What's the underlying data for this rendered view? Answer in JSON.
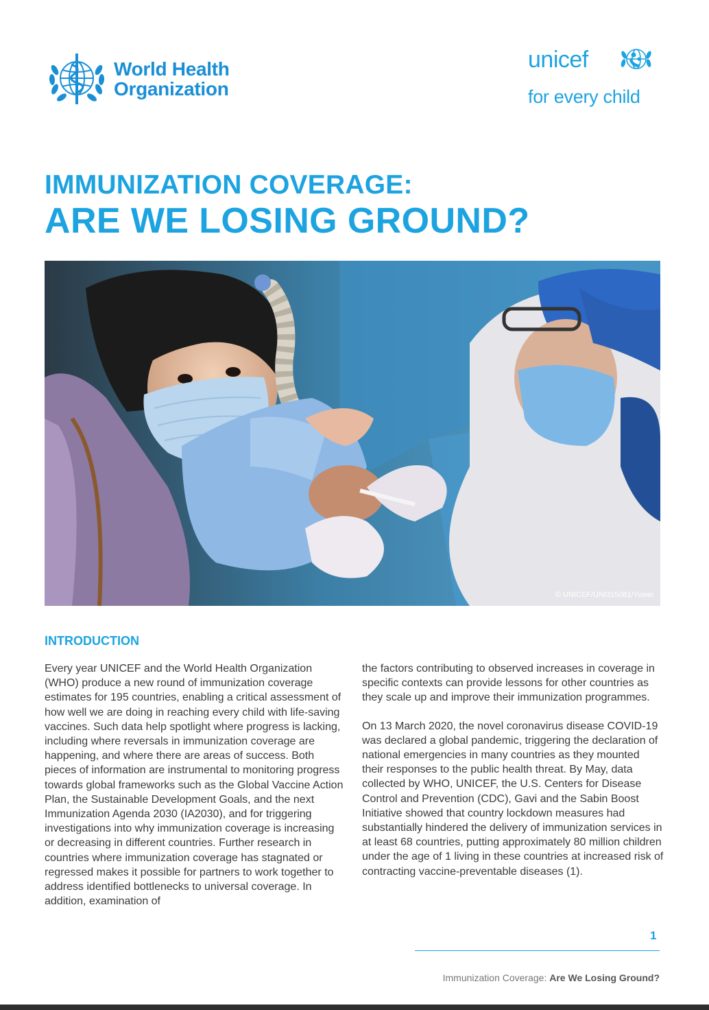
{
  "logos": {
    "who": {
      "line1": "World Health",
      "line2": "Organization",
      "color": "#1a8fd6"
    },
    "unicef": {
      "name": "unicef",
      "tagline": "for every child",
      "color": "#1ca3e0"
    }
  },
  "title": {
    "line1": "IMMUNIZATION COVERAGE:",
    "line2": "ARE WE LOSING GROUND?",
    "color": "#1ca3e0"
  },
  "photo": {
    "credit": "© UNICEF/UNI315081/Yuwei"
  },
  "intro": {
    "heading": "INTRODUCTION",
    "left_paragraph": "Every year UNICEF and the World Health Organization (WHO) produce a new round of immunization coverage estimates for 195 countries, enabling a critical assessment of how well we are doing in reaching every child with life-saving vaccines. Such data help spotlight where progress is lacking, including where reversals in immunization coverage are happening, and where there are areas of success. Both pieces of information are instrumental to monitoring progress towards global frameworks such as the Global Vaccine Action Plan, the Sustainable Development Goals, and the next Immunization Agenda 2030 (IA2030), and for triggering investigations into why immunization coverage is increasing or decreasing in different countries. Further research in countries where immunization coverage has stagnated or regressed makes it possible for partners to work together to address identified bottlenecks to universal coverage. In addition, examination of",
    "right_paragraph_1": "the factors contributing to observed increases in coverage in specific contexts can provide lessons for other countries as they scale up and improve their immunization programmes.",
    "right_paragraph_2": "On 13 March 2020, the novel coronavirus disease COVID-19 was declared a global pandemic, triggering the declaration of national emergencies in many countries as they mounted their responses to the public health threat. By May, data collected by WHO, UNICEF, the U.S. Centers for Disease Control and Prevention (CDC), Gavi and the Sabin Boost Initiative showed that country lockdown measures had substantially hindered the delivery of immunization services in at least 68 countries, putting approximately 80 million children under the age of 1 living in these countries at increased risk of contracting vaccine-preventable diseases (1)."
  },
  "footer": {
    "page_number": "1",
    "doc_title_plain": "Immunization Coverage:",
    "doc_title_bold": "Are We Losing Ground?"
  }
}
